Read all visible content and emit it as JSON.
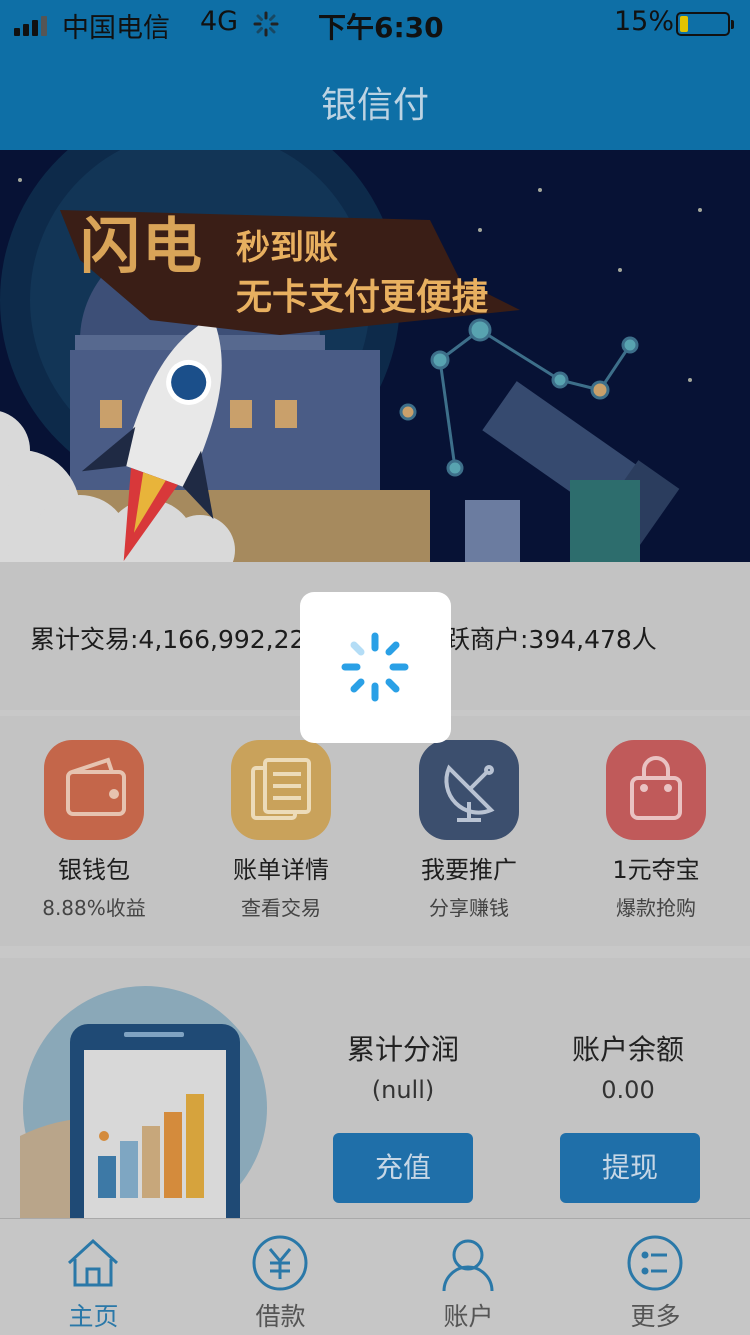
{
  "status_bar": {
    "carrier": "中国电信",
    "network": "4G",
    "time": "下午6:30",
    "battery": "15%"
  },
  "nav": {
    "title": "银信付"
  },
  "banner": {
    "headline_big": "闪电",
    "headline_small": "秒到账",
    "tagline": "无卡支付更便捷"
  },
  "stats": {
    "total_trade": "累计交易:4,166,992,22",
    "active_merchants": "活跃商户:394,478人"
  },
  "grid": [
    {
      "label": "银钱包",
      "sub": "8.88%收益",
      "icon": "wallet-icon",
      "color": "#c4664a"
    },
    {
      "label": "账单详情",
      "sub": "查看交易",
      "icon": "bill-icon",
      "color": "#c9a25b"
    },
    {
      "label": "我要推广",
      "sub": "分享赚钱",
      "icon": "satellite-dish-icon",
      "color": "#3c4f6e"
    },
    {
      "label": "1元夺宝",
      "sub": "爆款抢购",
      "icon": "shopping-bag-icon",
      "color": "#c05a5a"
    }
  ],
  "profit": {
    "share_label": "累计分润",
    "share_value": "(null)",
    "balance_label": "账户余额",
    "balance_value": "0.00",
    "recharge_button": "充值",
    "withdraw_button": "提现"
  },
  "tabs": [
    {
      "label": "主页",
      "icon": "home-icon",
      "active": true
    },
    {
      "label": "借款",
      "icon": "yuan-icon",
      "active": false
    },
    {
      "label": "账户",
      "icon": "user-icon",
      "active": false
    },
    {
      "label": "更多",
      "icon": "more-list-icon",
      "active": false
    }
  ],
  "colors": {
    "header": "#0e6fa6",
    "accent": "#1f6fa9",
    "tab_active": "#2a78a8",
    "spinner": "#2aa0e6"
  }
}
